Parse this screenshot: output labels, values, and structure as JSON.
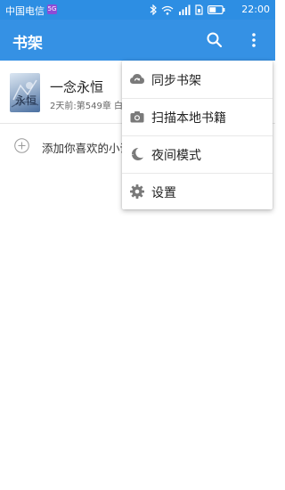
{
  "status_bar": {
    "carrier": "中国电信",
    "carrier_badge": "5G",
    "time": "22:00",
    "icons": [
      "bluetooth-icon",
      "wifi-icon",
      "signal-icon",
      "sim-icon",
      "battery-icon"
    ]
  },
  "app_bar": {
    "title": "书架",
    "actions": [
      "search-icon",
      "more-vert-icon"
    ]
  },
  "books": [
    {
      "title": "一念永恒",
      "progress": "2天前:第549章 白小",
      "cover_text": "永恒"
    }
  ],
  "add_book": {
    "label": "添加你喜欢的小说"
  },
  "menu": {
    "items": [
      {
        "label": "同步书架",
        "icon": "cloud-sync-icon"
      },
      {
        "label": "扫描本地书籍",
        "icon": "camera-icon"
      },
      {
        "label": "夜间模式",
        "icon": "moon-icon"
      },
      {
        "label": "设置",
        "icon": "gear-icon"
      }
    ]
  },
  "colors": {
    "status_bar": "#2d8ee3",
    "app_bar": "#3591e4",
    "menu_icon": "#7a7a7a"
  }
}
